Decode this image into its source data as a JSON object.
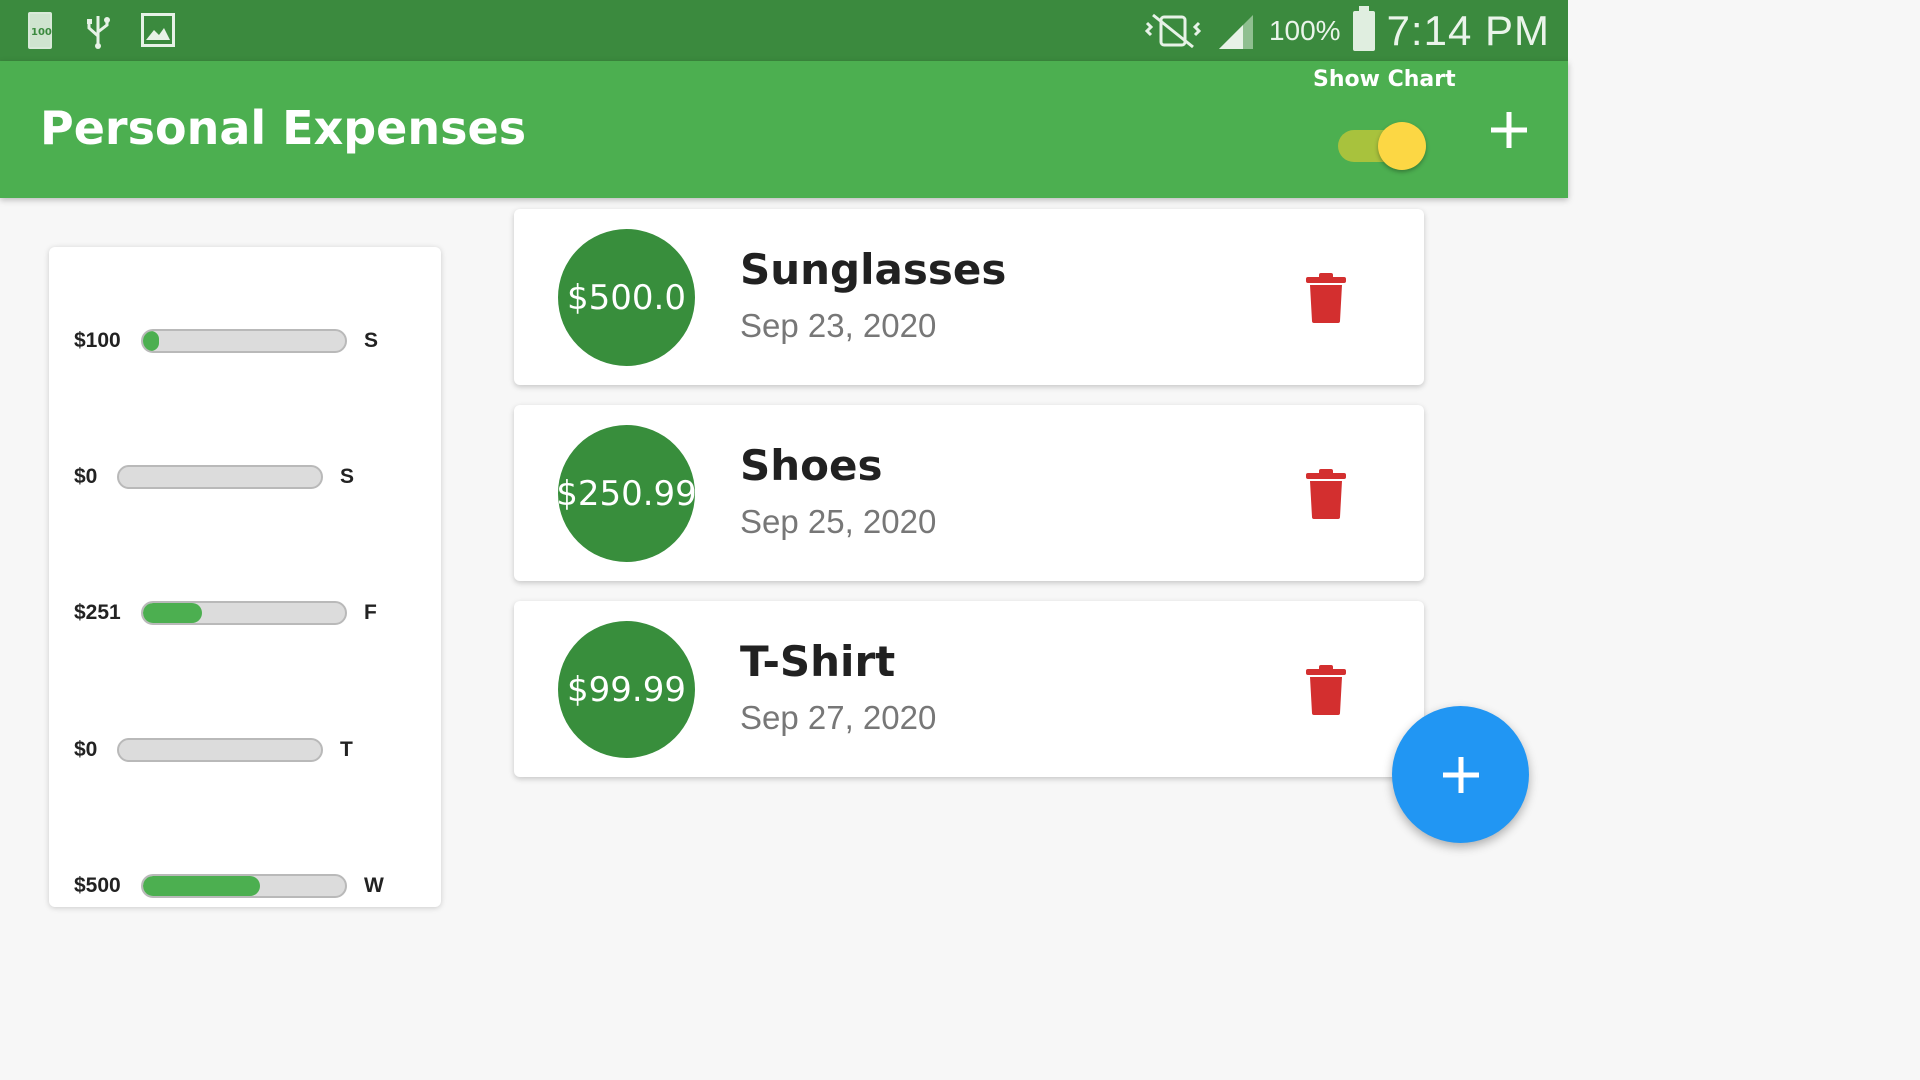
{
  "status_bar": {
    "battery_card_text": "100",
    "battery_percent": "100%",
    "time": "7:14 PM"
  },
  "app_bar": {
    "title": "Personal Expenses",
    "show_chart_label": "Show Chart",
    "show_chart_on": true
  },
  "chart": {
    "bars": [
      {
        "amount": "$100",
        "day": "S",
        "fill_fraction": 0.08
      },
      {
        "amount": "$0",
        "day": "S",
        "fill_fraction": 0.0
      },
      {
        "amount": "$251",
        "day": "F",
        "fill_fraction": 0.29
      },
      {
        "amount": "$0",
        "day": "T",
        "fill_fraction": 0.0
      },
      {
        "amount": "$500",
        "day": "W",
        "fill_fraction": 0.58
      }
    ]
  },
  "transactions": [
    {
      "amount": "$500.0",
      "title": "Sunglasses",
      "date": "Sep 23, 2020"
    },
    {
      "amount": "$250.99",
      "title": "Shoes",
      "date": "Sep 25, 2020"
    },
    {
      "amount": "$99.99",
      "title": "T-Shirt",
      "date": "Sep 27, 2020"
    }
  ],
  "colors": {
    "primary": "#4caf50",
    "primary_dark": "#3b8a3e",
    "amount_circle": "#388e3c",
    "accent_switch": "#fcd744",
    "delete": "#d32f2f",
    "fab": "#2196f3"
  },
  "icons": {
    "delete": "trash-icon",
    "add": "plus-icon"
  }
}
